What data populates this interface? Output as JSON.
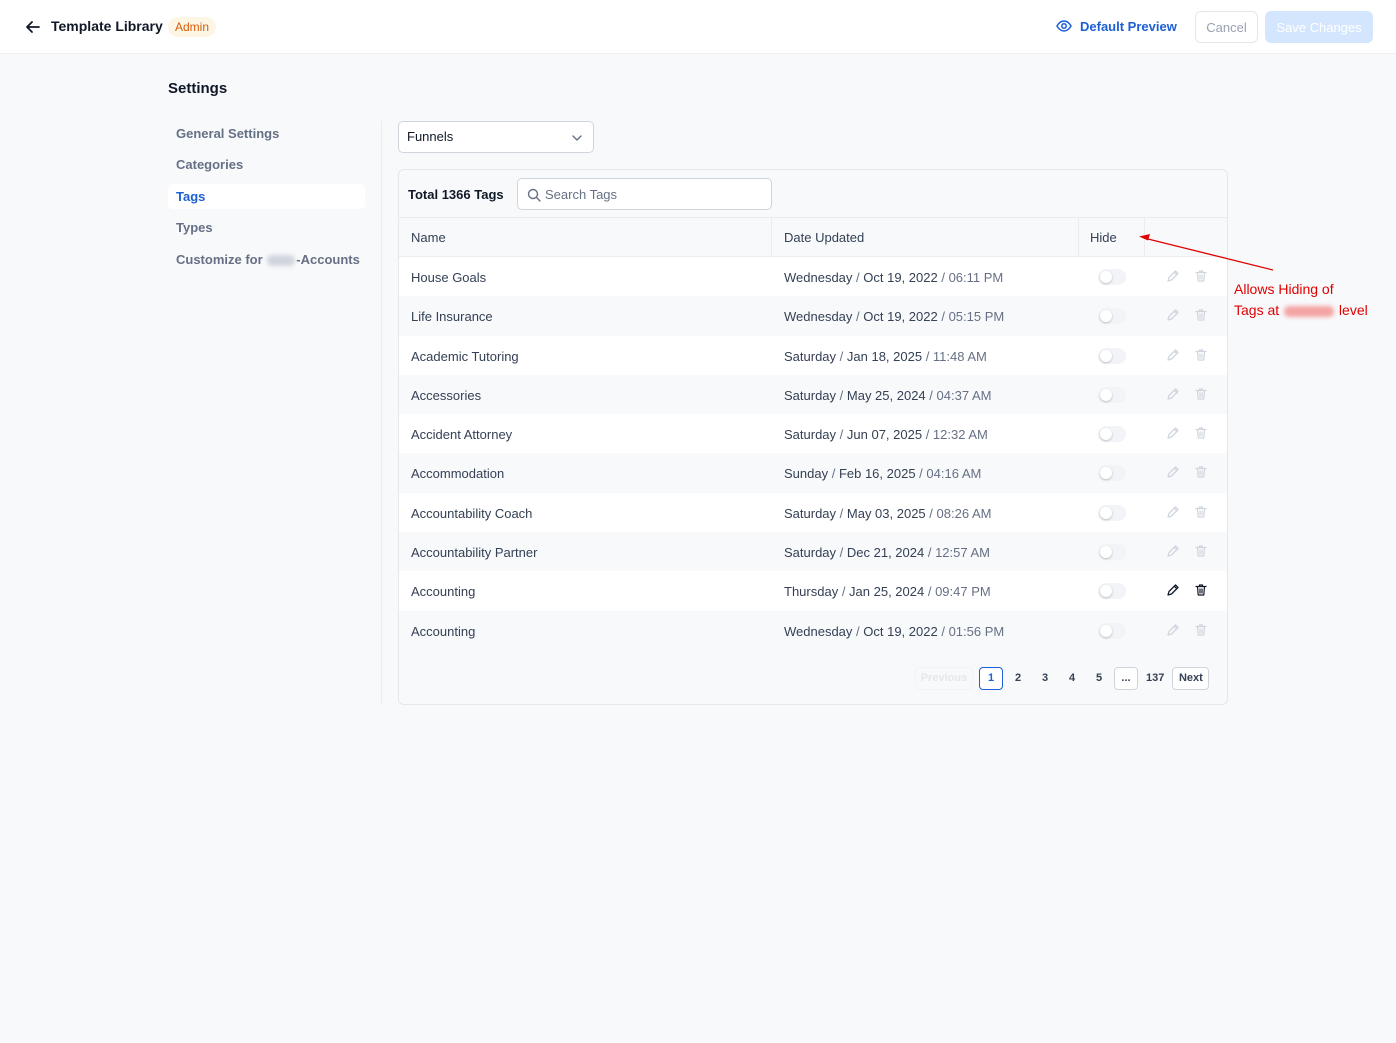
{
  "header": {
    "title": "Template Library",
    "badge": "Admin",
    "preview_label": "Default Preview",
    "cancel_label": "Cancel",
    "save_label": "Save Changes"
  },
  "sidebar": {
    "title": "Settings",
    "items": [
      {
        "label": "General Settings",
        "active": false
      },
      {
        "label": "Categories",
        "active": false
      },
      {
        "label": "Tags",
        "active": true
      },
      {
        "label": "Types",
        "active": false
      },
      {
        "label_before": "Customize for ",
        "label_after": "-Accounts",
        "active": false
      }
    ]
  },
  "filter": {
    "selected": "Funnels"
  },
  "tags": {
    "total_label": "Total 1366 Tags",
    "search_placeholder": "Search Tags",
    "columns": {
      "name": "Name",
      "date": "Date Updated",
      "hide": "Hide"
    },
    "rows": [
      {
        "name": "House Goals",
        "day": "Wednesday",
        "date": "Oct 19, 2022",
        "time": "06:11 PM"
      },
      {
        "name": "Life Insurance",
        "day": "Wednesday",
        "date": "Oct 19, 2022",
        "time": "05:15 PM"
      },
      {
        "name": "Academic Tutoring",
        "day": "Saturday",
        "date": "Jan 18, 2025",
        "time": "11:48 AM"
      },
      {
        "name": "Accessories",
        "day": "Saturday",
        "date": "May 25, 2024",
        "time": "04:37 AM"
      },
      {
        "name": "Accident Attorney",
        "day": "Saturday",
        "date": "Jun 07, 2025",
        "time": "12:32 AM"
      },
      {
        "name": "Accommodation",
        "day": "Sunday",
        "date": "Feb 16, 2025",
        "time": "04:16 AM"
      },
      {
        "name": "Accountability Coach",
        "day": "Saturday",
        "date": "May 03, 2025",
        "time": "08:26 AM"
      },
      {
        "name": "Accountability Partner",
        "day": "Saturday",
        "date": "Dec 21, 2024",
        "time": "12:57 AM"
      },
      {
        "name": "Accounting",
        "day": "Thursday",
        "date": "Jan 25, 2024",
        "time": "09:47 PM",
        "hovered": true
      },
      {
        "name": "Accounting",
        "day": "Wednesday",
        "date": "Oct 19, 2022",
        "time": "01:56 PM"
      }
    ]
  },
  "pagination": {
    "previous": "Previous",
    "pages": [
      "1",
      "2",
      "3",
      "4",
      "5"
    ],
    "current": "1",
    "ellipsis": "...",
    "last": "137",
    "next": "Next"
  },
  "annotation": {
    "line1": "Allows Hiding of",
    "line2_before": "Tags at",
    "line2_after": "level",
    "color": "#e00000"
  },
  "colors": {
    "accent": "#1d5fd6",
    "badge_text": "#d25c0b",
    "badge_bg": "#fef6e4",
    "save_disabled": "#d4e6fd"
  }
}
